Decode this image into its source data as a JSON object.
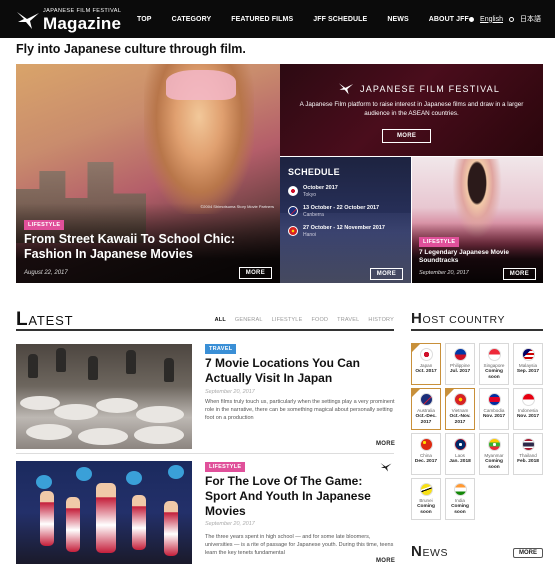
{
  "nav": {
    "logo_top": "JAPANESE FILM FESTIVAL",
    "logo_main": "Magazine",
    "items": [
      "TOP",
      "CATEGORY",
      "FEATURED FILMS",
      "JFF SCHEDULE",
      "NEWS",
      "ABOUT JFF"
    ],
    "lang_en": "English",
    "lang_jp": "日本語"
  },
  "tagline": "Fly into Japanese culture through film.",
  "hero": {
    "tag": "LIFESTYLE",
    "title": "From Street Kawaii To School Chic: Fashion In Japanese Movies",
    "date": "August 22, 2017",
    "more": "MORE",
    "credit": "©2004 Shimotsuma Story Movie Partners"
  },
  "jff": {
    "title": "JAPANESE FILM FESTIVAL",
    "text": "A Japanese Film platform to raise interest in Japanese films and draw in a larger audience in the ASEAN countries.",
    "more": "MORE"
  },
  "schedule": {
    "title": "SCHEDULE",
    "rows": [
      {
        "date": "October 2017",
        "city": "Tokyo"
      },
      {
        "date": "13 October - 22 October 2017",
        "city": "Canberra"
      },
      {
        "date": "27 October - 12 November 2017",
        "city": "Hanoi"
      }
    ],
    "more": "MORE"
  },
  "card2": {
    "tag": "LIFESTYLE",
    "title": "7 Legendary Japanese Movie Soundtracks",
    "date": "September 20, 2017",
    "more": "MORE"
  },
  "latest": {
    "title_cap": "L",
    "title_rest": "ATEST",
    "filters": [
      "ALL",
      "GENERAL",
      "LIFESTYLE",
      "FOOD",
      "TRAVEL",
      "HISTORY"
    ],
    "articles": [
      {
        "tag": "TRAVEL",
        "title": "7 Movie Locations You Can Actually Visit In Japan",
        "date": "September 20, 2017",
        "text": "When films truly touch us, particularly when the settings play a very prominent role in the narrative, there can be something magical about personally setting foot on a production",
        "more": "MORE"
      },
      {
        "tag": "LIFESTYLE",
        "title": "For The Love Of The Game: Sport And Youth In Japanese Movies",
        "date": "September 20, 2017",
        "text": "The three years spent in high school — and for some late bloomers, universities — is a rite of passage for Japanese youth. During this time, teens learn the key tenets fundamental",
        "more": "MORE"
      }
    ]
  },
  "host": {
    "title_cap": "H",
    "title_rest": "OST COUNTRY",
    "countries": [
      {
        "name": "Japan",
        "date": "Oct. 2017",
        "flag": "japan",
        "past": true
      },
      {
        "name": "Philippine",
        "date": "Jul. 2017",
        "flag": "philippines",
        "past": false
      },
      {
        "name": "Singapore",
        "date": "Coming soon",
        "flag": "singapore",
        "past": false
      },
      {
        "name": "Malaysia",
        "date": "Sep. 2017",
        "flag": "malaysia",
        "past": false
      },
      {
        "name": "Australia",
        "date": "Oct.-Dec. 2017",
        "flag": "australia",
        "past": true
      },
      {
        "name": "Vietnam",
        "date": "Oct.-Nov. 2017",
        "flag": "vietnam",
        "past": true
      },
      {
        "name": "Cambodia",
        "date": "Nov. 2017",
        "flag": "cambodia",
        "past": false
      },
      {
        "name": "Indonesia",
        "date": "Nov. 2017",
        "flag": "indonesia",
        "past": false
      },
      {
        "name": "China",
        "date": "Dec. 2017",
        "flag": "china",
        "past": false
      },
      {
        "name": "Laos",
        "date": "Jan. 2018",
        "flag": "laos",
        "past": false
      },
      {
        "name": "Myanmar",
        "date": "Coming soon",
        "flag": "myanmar",
        "past": false
      },
      {
        "name": "Thailand",
        "date": "Feb. 2018",
        "flag": "thailand",
        "past": false
      },
      {
        "name": "Brunei",
        "date": "Coming soon",
        "flag": "brunei",
        "past": false
      },
      {
        "name": "India",
        "date": "Coming soon",
        "flag": "india",
        "past": false
      }
    ]
  },
  "news": {
    "title_cap": "N",
    "title_rest": "EWS",
    "more": "MORE"
  },
  "colors": {
    "accent_pink": "#e0509a",
    "accent_blue": "#3a8fd6",
    "nav_bg": "#0b0b0b",
    "past_border": "#c8903a"
  }
}
